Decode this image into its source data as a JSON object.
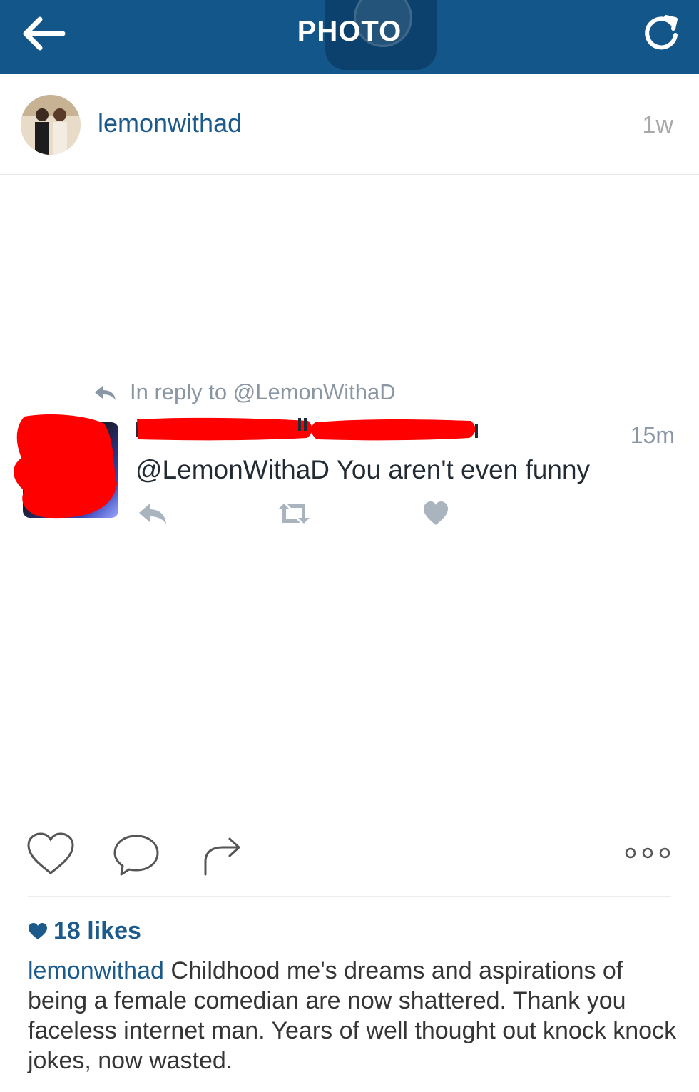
{
  "nav": {
    "title": "PHOTO",
    "back_icon": "arrow-left-icon",
    "refresh_icon": "refresh-icon",
    "bg_color": "#13568a"
  },
  "post": {
    "username": "lemonwithad",
    "time_ago": "1w"
  },
  "tweet": {
    "reply_to": "In reply to @LemonWithaD",
    "time": "15m",
    "text": "@LemonWithaD You aren't even funny",
    "actions": [
      "reply-icon",
      "retweet-icon",
      "like-icon"
    ]
  },
  "actions": {
    "like_icon": "heart-outline-icon",
    "comment_icon": "comment-icon",
    "share_icon": "share-icon",
    "more_icon": "more-options-icon"
  },
  "likes": {
    "text": "18 likes"
  },
  "caption": {
    "username": "lemonwithad",
    "text": "Childhood me's dreams and aspirations of being a female comedian are now shattered. Thank you faceless internet man. Years of well thought out knock knock jokes, now wasted."
  },
  "colors": {
    "link_blue": "#1c5a8c",
    "redaction_red": "#ff0000",
    "twitter_gray": "#8a96a3"
  }
}
